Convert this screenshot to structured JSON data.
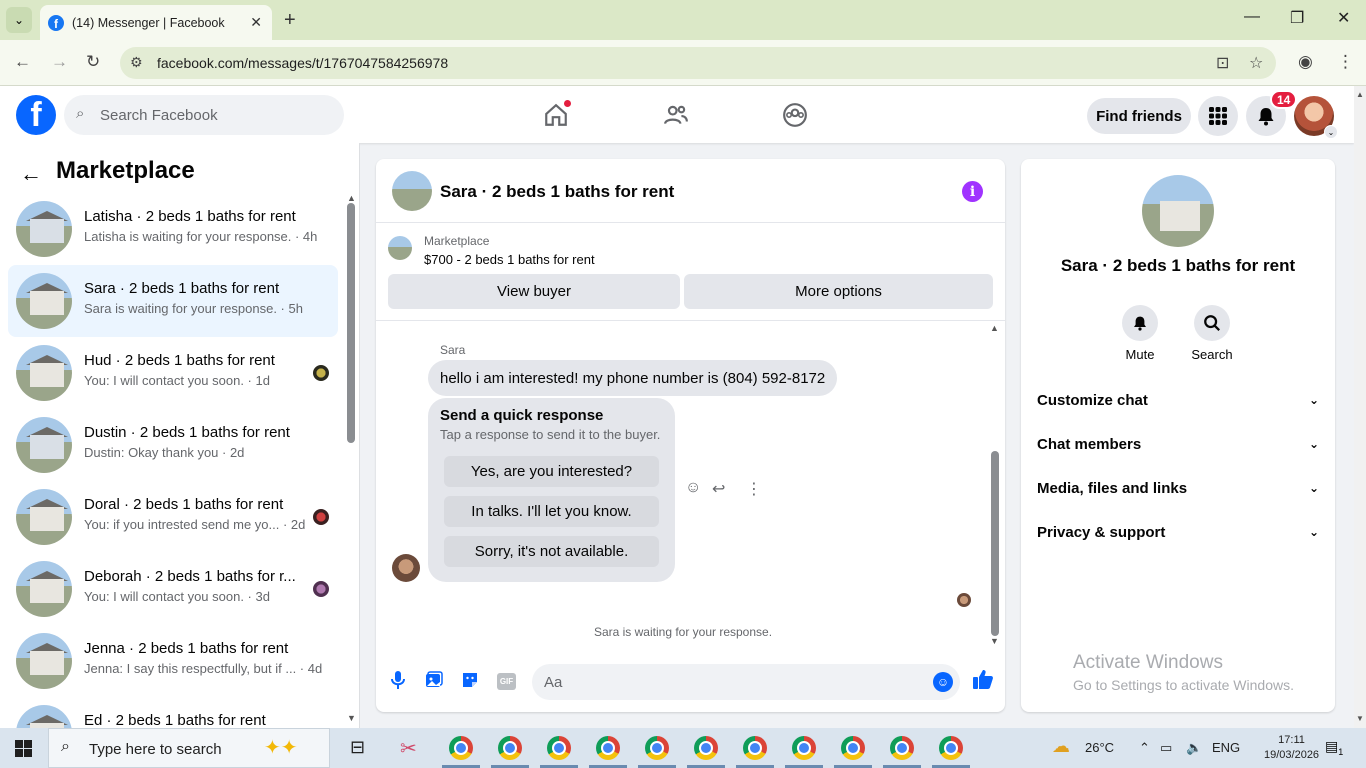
{
  "browser": {
    "tab_title": "(14) Messenger | Facebook",
    "tab_close": "✕",
    "new_tab": "+",
    "url": "facebook.com/messages/t/1767047584256978"
  },
  "header": {
    "search_placeholder": "Search Facebook",
    "find_friends": "Find friends",
    "notification_count": "14"
  },
  "sidebar": {
    "title": "Marketplace",
    "conversations": [
      {
        "name": "Latisha · 2 beds 1 baths for rent",
        "preview": "Latisha is waiting for your response. · 4h",
        "active": false
      },
      {
        "name": "Sara · 2 beds 1 baths for rent",
        "preview": "Sara is waiting for your response. · 5h",
        "active": true
      },
      {
        "name": "Hud · 2 beds 1 baths for rent",
        "preview": "You: I will contact you soon. · 1d",
        "active": false
      },
      {
        "name": "Dustin · 2 beds 1 baths for rent",
        "preview": "Dustin: Okay thank you · 2d",
        "active": false
      },
      {
        "name": "Doral · 2 beds 1 baths for rent",
        "preview": "You: if you intrested send me yo... · 2d",
        "active": false
      },
      {
        "name": "Deborah · 2 beds 1 baths for r...",
        "preview": "You: I will contact you soon. · 3d",
        "active": false
      },
      {
        "name": "Jenna · 2 beds 1 baths for rent",
        "preview": "Jenna: I say this respectfully, but if ... · 4d",
        "active": false
      },
      {
        "name": "Ed · 2 beds 1 baths for rent",
        "preview": "",
        "active": false
      }
    ]
  },
  "chat": {
    "title": "Sara · 2 beds 1 baths for rent",
    "marketplace_label": "Marketplace",
    "listing": "$700 - 2 beds 1 baths for rent",
    "view_buyer": "View buyer",
    "more_options": "More options",
    "sender": "Sara",
    "message": "hello i am interested! my phone number is (804) 592-8172",
    "quick_title": "Send a quick response",
    "quick_sub": "Tap a response to send it to the buyer.",
    "quick_responses": [
      "Yes, are you interested?",
      "In talks. I'll let you know.",
      "Sorry, it's not available."
    ],
    "waiting": "Sara is waiting for your response.",
    "composer_placeholder": "Aa",
    "gif_label": "GIF"
  },
  "details": {
    "name": "Sara · 2 beds 1 baths for rent",
    "mute": "Mute",
    "search": "Search",
    "sections": [
      "Customize chat",
      "Chat members",
      "Media, files and links",
      "Privacy & support"
    ],
    "activate_title": "Activate Windows",
    "activate_sub": "Go to Settings to activate Windows."
  },
  "taskbar": {
    "search_text": "Type here to search",
    "weather": "26°C",
    "language": "ENG",
    "time": "17:11",
    "date": "19/03/2026",
    "notification_count": "1"
  }
}
